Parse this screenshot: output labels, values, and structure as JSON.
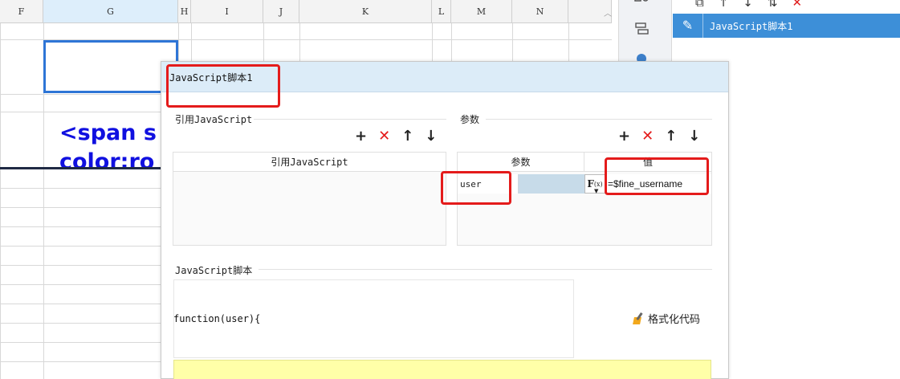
{
  "sheet": {
    "columns": [
      {
        "label": "F",
        "selected": false
      },
      {
        "label": "G",
        "selected": true
      },
      {
        "label": "H",
        "selected": false
      },
      {
        "label": "I",
        "selected": false
      },
      {
        "label": "J",
        "selected": false
      },
      {
        "label": "K",
        "selected": false
      },
      {
        "label": "L",
        "selected": false
      },
      {
        "label": "M",
        "selected": false
      },
      {
        "label": "N",
        "selected": false
      }
    ],
    "cell_text_line1": "<span s",
    "cell_text_line2": "color:ro",
    "scroll_up_icon": "chevron-up-icon"
  },
  "toolstrip": {
    "icons": [
      "cell-element-icon",
      "widget-icon",
      "condition-icon"
    ]
  },
  "right_panel": {
    "toolbar_icons": [
      "copy-icon",
      "move-up-icon",
      "move-down-icon",
      "sort-icon",
      "delete-icon"
    ],
    "item_label": "JavaScript脚本1"
  },
  "dialog": {
    "title": "JavaScript脚本1",
    "ref_js": {
      "section_label": "引用JavaScript",
      "column_header": "引用JavaScript"
    },
    "params": {
      "section_label": "参数",
      "col_param": "参数",
      "col_value": "值",
      "rows": [
        {
          "name": "user",
          "value": "=$fine_username"
        }
      ]
    },
    "script": {
      "section_label": "JavaScript脚本",
      "code_line": "function(user){",
      "format_label": "格式化代码"
    },
    "toolbar": {
      "add": "+",
      "delete": "✕",
      "up": "↑",
      "down": "↓"
    }
  },
  "colors": {
    "selection_blue": "#2e75d6",
    "highlight_red": "#e41b1b",
    "title_bar": "#dcecf8",
    "panel_selected": "#3d8fd8",
    "editor_yellow": "#ffffa8"
  }
}
